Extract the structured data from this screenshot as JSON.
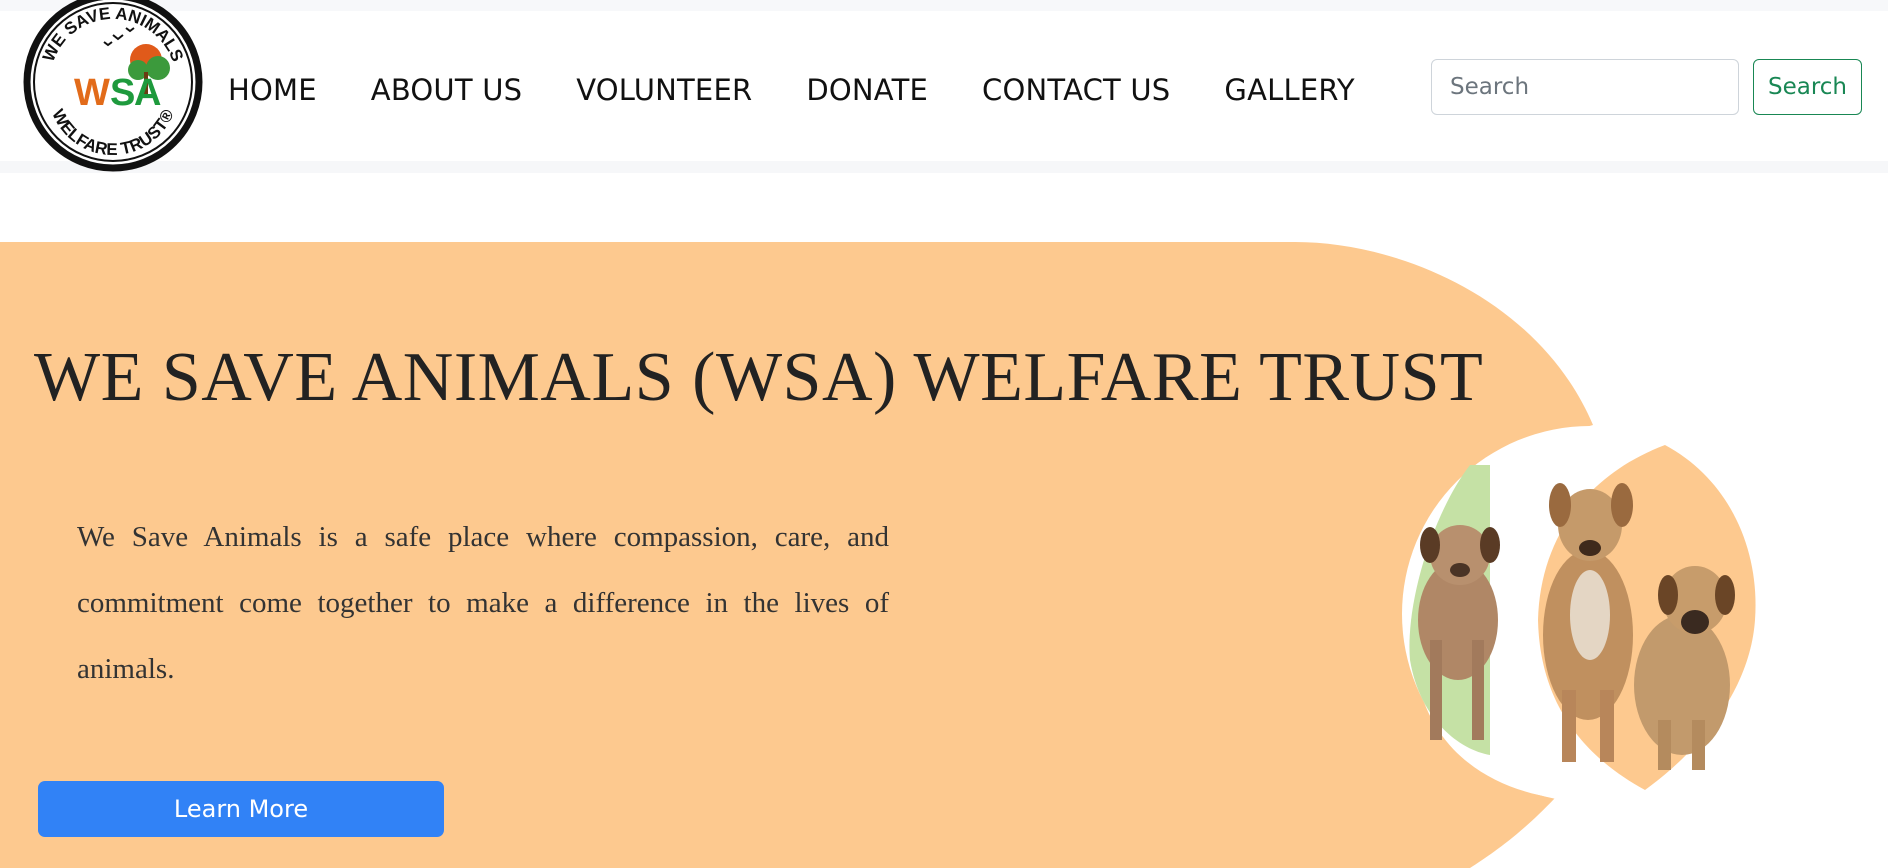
{
  "colors": {
    "hero_background": "#fdc98f",
    "primary_button": "#3182f6",
    "search_button_border": "#198754",
    "accent_green": "#c5e1a5"
  },
  "logo": {
    "icon": "wsa-welfare-trust-logo",
    "text_top": "WE SAVE ANIMALS",
    "text_bottom": "WELFARE TRUST®",
    "monogram": "WSA"
  },
  "nav": {
    "items": [
      {
        "label": "HOME"
      },
      {
        "label": "ABOUT US"
      },
      {
        "label": "VOLUNTEER"
      },
      {
        "label": "DONATE"
      },
      {
        "label": "CONTACT US"
      },
      {
        "label": "GALLERY"
      }
    ]
  },
  "search": {
    "placeholder": "Search",
    "value": "",
    "button_label": "Search"
  },
  "hero": {
    "title": "WE SAVE ANIMALS (WSA) WELFARE TRUST",
    "description": "We Save Animals is a safe place where compassion, care, and commitment come together to make a difference in the lives of animals.",
    "button_label": "Learn More",
    "image": "three-puppies-illustration"
  }
}
